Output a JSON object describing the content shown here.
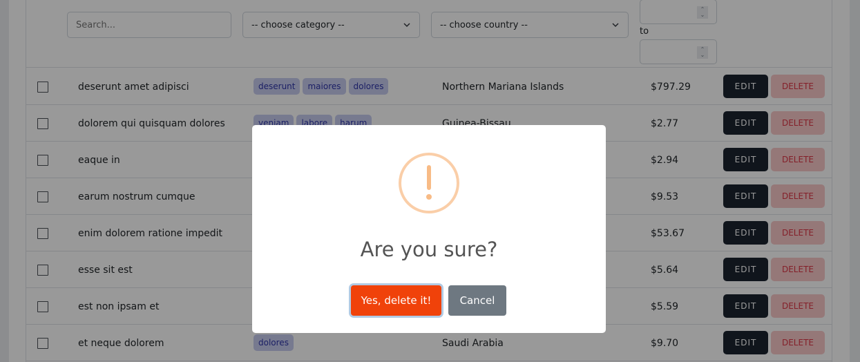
{
  "filters": {
    "search_placeholder": "Search...",
    "category_select": "-- choose category --",
    "country_select": "-- choose country --",
    "price_from": "",
    "price_to": "",
    "to_label": "to"
  },
  "table": {
    "edit_label": "EDIT",
    "delete_label": "DELETE",
    "rows": [
      {
        "name": "deserunt amet adipisci",
        "tags": [
          "deserunt",
          "maiores",
          "dolores"
        ],
        "country": "Northern Mariana Islands",
        "price": "$797.29"
      },
      {
        "name": "dolorem qui quisquam dolores",
        "tags": [
          "veniam",
          "labore",
          "harum"
        ],
        "country": "Guinea-Bissau",
        "price": "$2.77"
      },
      {
        "name": "eaque in",
        "tags": [],
        "country": "",
        "price": "$2.94"
      },
      {
        "name": "earum nostrum cumque",
        "tags": [],
        "country": "",
        "price": "$9.53"
      },
      {
        "name": "enim dolorem ratione impedit",
        "tags": [],
        "country": "",
        "price": "$53.67"
      },
      {
        "name": "esse sit est",
        "tags": [],
        "country": "",
        "price": "$5.64"
      },
      {
        "name": "est non ipsam et",
        "tags": [],
        "country": "",
        "price": "$5.59"
      },
      {
        "name": "et neque dolorem",
        "tags": [
          "dolores"
        ],
        "country": "Saudi Arabia",
        "price": "$9.70"
      }
    ]
  },
  "modal": {
    "icon": "warning-icon",
    "title": "Are you sure?",
    "confirm_label": "Yes, delete it!",
    "cancel_label": "Cancel",
    "confirm_color": "#f0420a",
    "cancel_color": "#6e7881"
  }
}
